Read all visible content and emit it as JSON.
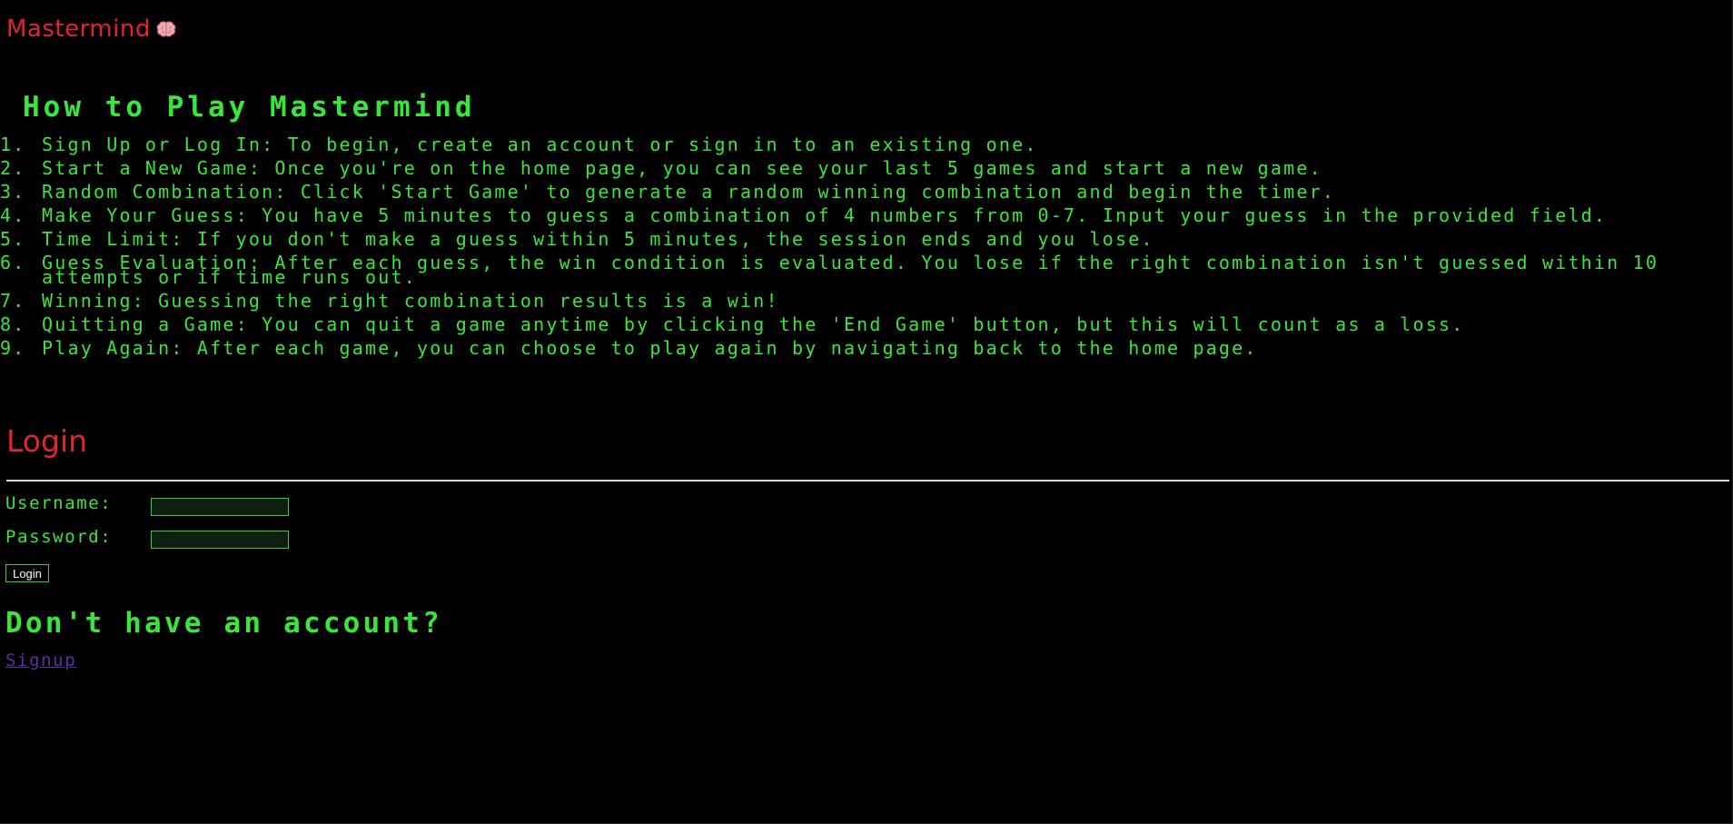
{
  "header": {
    "brand": "Mastermind",
    "brand_icon": "brain-icon"
  },
  "howto": {
    "title": "How to Play Mastermind",
    "rules": [
      {
        "num": "1.",
        "text": "Sign Up or Log In: To begin, create an account or sign in to an existing one."
      },
      {
        "num": "2.",
        "text": "Start a New Game: Once you're on the home page, you can see your last 5 games and start a new game."
      },
      {
        "num": "3.",
        "text": "Random Combination: Click 'Start Game' to generate a random winning combination and begin the timer."
      },
      {
        "num": "4.",
        "text": "Make Your Guess: You have 5 minutes to guess a combination of 4 numbers from 0-7. Input your guess in the provided field."
      },
      {
        "num": "5.",
        "text": "Time Limit: If you don't make a guess within 5 minutes, the session ends and you lose."
      },
      {
        "num": "6.",
        "text": "Guess Evaluation: After each guess, the win condition is evaluated. You lose if the right combination isn't guessed within 10 attempts or if time runs out."
      },
      {
        "num": "7.",
        "text": "Winning: Guessing the right combination results is a win!"
      },
      {
        "num": "8.",
        "text": "Quitting a Game: You can quit a game anytime by clicking the 'End Game' button, but this will count as a loss."
      },
      {
        "num": "9.",
        "text": "Play Again: After each game, you can choose to play again by navigating back to the home page."
      }
    ]
  },
  "login": {
    "title": "Login",
    "username_label": "Username:",
    "username_value": "",
    "password_label": "Password:",
    "password_value": "",
    "submit_label": "Login"
  },
  "signup": {
    "prompt": "Don't have an account?",
    "link_label": "Signup"
  },
  "colors": {
    "background": "#000000",
    "accent_red": "#e0262c",
    "text_green": "#39e639",
    "link_purple": "#5b2fa8"
  }
}
